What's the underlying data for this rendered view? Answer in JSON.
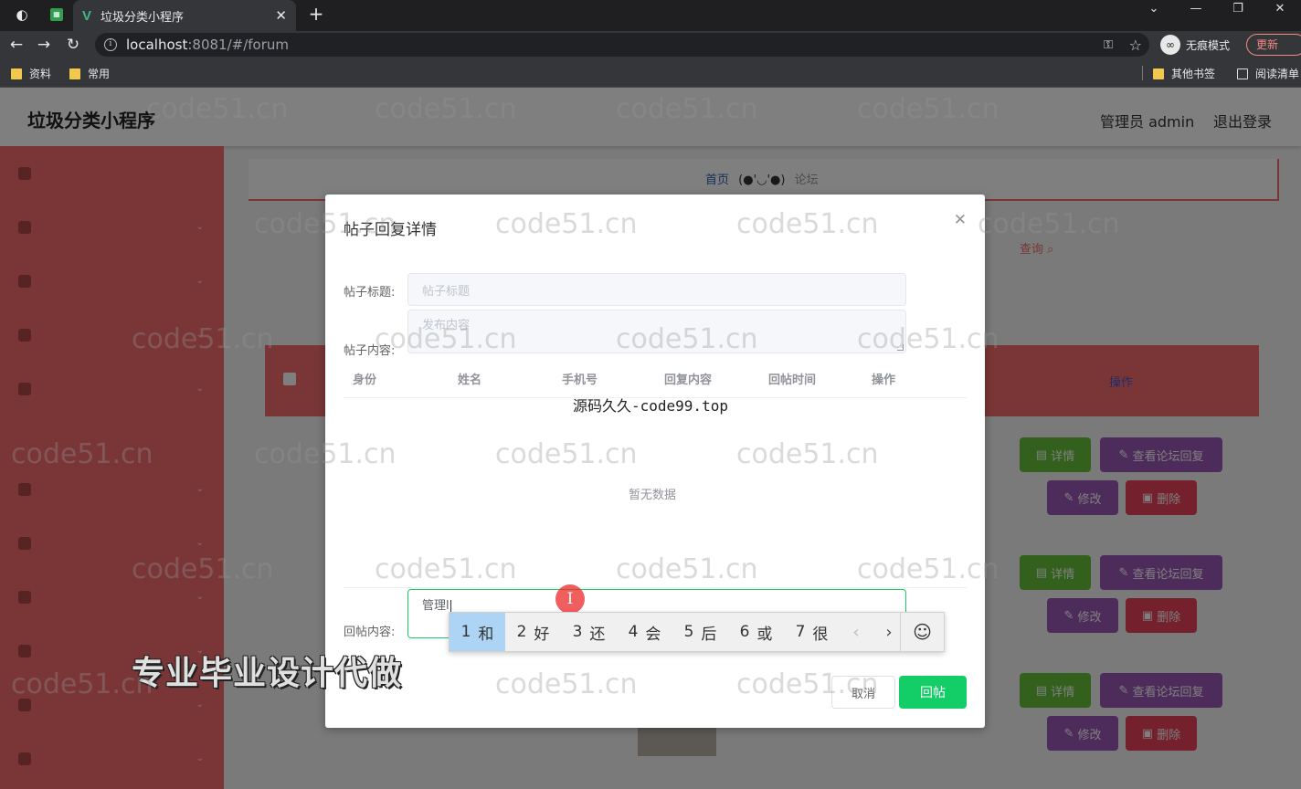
{
  "browser": {
    "tab_title": "垃圾分类小程序",
    "url_host": "localhost",
    "url_path": ":8081/#/forum",
    "incognito_label": "无痕模式",
    "update_label": "更新",
    "bookmarks": [
      "资料",
      "常用"
    ],
    "other_bookmarks": "其他书签",
    "reading_list": "阅读清单"
  },
  "app": {
    "title": "垃圾分类小程序",
    "admin_label": "管理员 admin",
    "logout": "退出登录",
    "breadcrumb": {
      "home": "首页",
      "face": "(●'◡'●)",
      "current": "论坛"
    },
    "search_label": "查询",
    "ops_header": "操作",
    "row_buttons": {
      "detail": "详情",
      "reply": "查看论坛回复",
      "edit": "修改",
      "delete": "删除"
    }
  },
  "dialog": {
    "title": "帖子回复详情",
    "post_title_label": "帖子标题:",
    "post_title_placeholder": "帖子标题",
    "post_content_label": "帖子内容:",
    "post_content_placeholder": "发布内容",
    "columns": [
      "身份",
      "姓名",
      "手机号",
      "回复内容",
      "回帖时间",
      "操作"
    ],
    "overlay_text": "源码久久-code99.top",
    "empty_text": "暂无数据",
    "reply_label": "回帖内容:",
    "reply_value": "管理l",
    "cancel": "取消",
    "submit": "回帖"
  },
  "ime": {
    "candidates": [
      {
        "num": "1",
        "text": "和"
      },
      {
        "num": "2",
        "text": "好"
      },
      {
        "num": "3",
        "text": "还"
      },
      {
        "num": "4",
        "text": "会"
      },
      {
        "num": "5",
        "text": "后"
      },
      {
        "num": "6",
        "text": "或"
      },
      {
        "num": "7",
        "text": "很"
      }
    ],
    "prev": "‹",
    "next": "›",
    "emoji": "☺"
  },
  "promo_text": "专业毕业设计代做",
  "watermark": "code51.cn",
  "colors": {
    "primary": "#f56c6c",
    "success": "#13ce66",
    "purple": "#9b59b6",
    "danger": "#e8405b"
  }
}
